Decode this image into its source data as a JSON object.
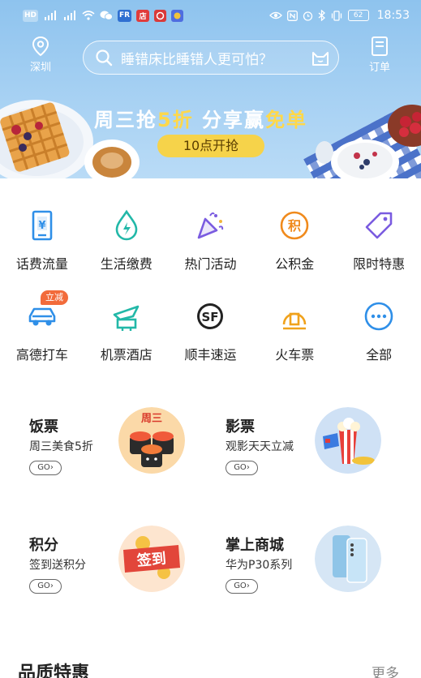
{
  "status_bar": {
    "left_icons": [
      "hd-icon",
      "4g-signal-icon",
      "4g-signal-icon",
      "wifi-icon",
      "wechat-icon",
      "fr-app-icon",
      "store-app-icon",
      "bank-app-icon",
      "paint-app-icon"
    ],
    "chip_fr": "FR",
    "chip_store": "店",
    "chip_hd": "HD",
    "battery": "62",
    "time": "18:53"
  },
  "header": {
    "location_label": "深圳",
    "search_placeholder": "睡错床比睡错人更可怕？",
    "orders_label": "订单"
  },
  "banner": {
    "headline_part1": "周三抢",
    "headline_highlight1": "5折",
    "headline_part2": " 分享赢",
    "headline_highlight2": "免单",
    "cta": "10点开抢"
  },
  "services_row1": [
    {
      "label": "话费流量",
      "icon": "phone-recharge-icon",
      "color": "#2f8fe8"
    },
    {
      "label": "生活缴费",
      "icon": "water-drop-icon",
      "color": "#22b8a8"
    },
    {
      "label": "热门活动",
      "icon": "party-popper-icon",
      "color": "#7a5be0"
    },
    {
      "label": "公积金",
      "icon": "fund-icon",
      "color": "#f08a1c"
    },
    {
      "label": "限时特惠",
      "icon": "price-tag-icon",
      "color": "#7a5be0"
    }
  ],
  "services_row2": [
    {
      "label": "高德打车",
      "icon": "car-icon",
      "color": "#2f8fe8",
      "badge": "立减"
    },
    {
      "label": "机票酒店",
      "icon": "plane-hotel-icon",
      "color": "#22b8a8"
    },
    {
      "label": "顺丰速运",
      "icon": "sf-express-icon",
      "color": "#222222"
    },
    {
      "label": "火车票",
      "icon": "train-icon",
      "color": "#f0a21c"
    },
    {
      "label": "全部",
      "icon": "more-icon",
      "color": "#2f8fe8"
    }
  ],
  "promos": [
    {
      "title": "饭票",
      "subtitle": "周三美食5折",
      "go": "GO",
      "art_text": "周三"
    },
    {
      "title": "影票",
      "subtitle": "观影天天立减",
      "go": "GO"
    },
    {
      "title": "积分",
      "subtitle": "签到送积分",
      "go": "GO",
      "art_text": "签到"
    },
    {
      "title": "掌上商城",
      "subtitle": "华为P30系列",
      "go": "GO"
    }
  ],
  "section": {
    "title": "品质特惠",
    "more": "更多"
  }
}
